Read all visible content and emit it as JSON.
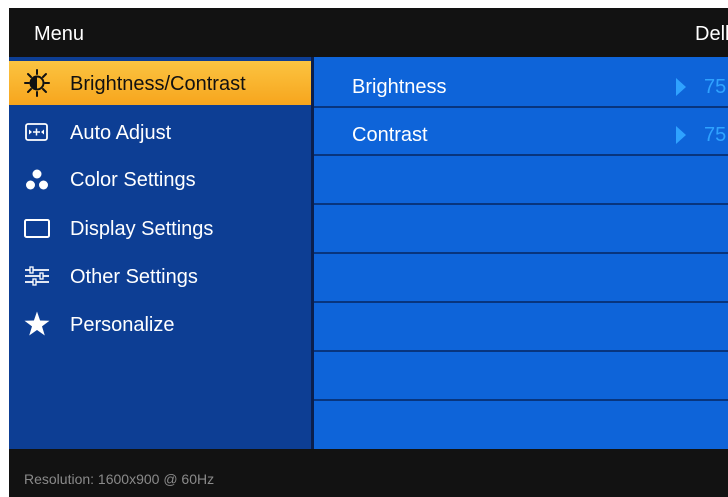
{
  "header": {
    "title": "Menu",
    "brand": "Dell"
  },
  "menu": {
    "items": [
      {
        "label": "Brightness/Contrast",
        "icon": "brightness-icon",
        "active": true
      },
      {
        "label": "Auto Adjust",
        "icon": "auto-adjust-icon",
        "active": false
      },
      {
        "label": "Color Settings",
        "icon": "color-settings-icon",
        "active": false
      },
      {
        "label": "Display Settings",
        "icon": "display-settings-icon",
        "active": false
      },
      {
        "label": "Other Settings",
        "icon": "other-settings-icon",
        "active": false
      },
      {
        "label": "Personalize",
        "icon": "star-icon",
        "active": false
      }
    ]
  },
  "settings": {
    "rows": [
      {
        "label": "Brightness",
        "value": "75"
      },
      {
        "label": "Contrast",
        "value": "75"
      }
    ]
  },
  "footer": {
    "resolution": "Resolution: 1600x900 @ 60Hz"
  },
  "colors": {
    "highlight": "#f9b42c",
    "menu_bg": "#0d3e94",
    "content_bg": "#0e64d9",
    "value_accent": "#2fa2ff",
    "bar_bg": "#121212"
  }
}
